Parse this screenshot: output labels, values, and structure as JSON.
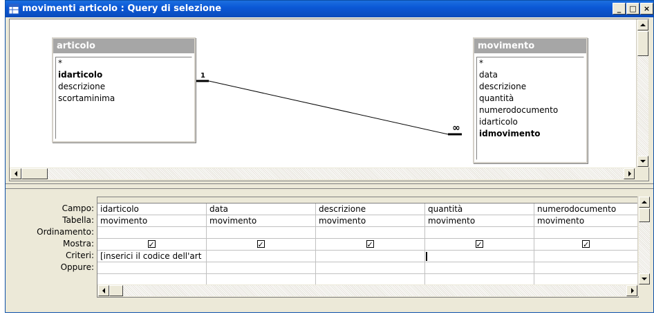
{
  "window": {
    "title": "movimenti articolo : Query di selezione",
    "controls": [
      "minimize",
      "maximize",
      "close"
    ]
  },
  "upper_pane": {
    "tables": [
      {
        "name": "articolo",
        "fields": [
          {
            "label": "*",
            "key": false
          },
          {
            "label": "idarticolo",
            "key": true
          },
          {
            "label": "descrizione",
            "key": false
          },
          {
            "label": "scortaminima",
            "key": false
          }
        ]
      },
      {
        "name": "movimento",
        "fields": [
          {
            "label": "*",
            "key": false
          },
          {
            "label": "data",
            "key": false
          },
          {
            "label": "descrizione",
            "key": false
          },
          {
            "label": "quantità",
            "key": false
          },
          {
            "label": "numerodocumento",
            "key": false
          },
          {
            "label": "idarticolo",
            "key": false
          },
          {
            "label": "idmovimento",
            "key": true
          }
        ]
      }
    ],
    "relationship": {
      "one_label": "1",
      "many_label": "∞"
    }
  },
  "grid": {
    "row_labels": [
      "Campo:",
      "Tabella:",
      "Ordinamento:",
      "Mostra:",
      "Criteri:",
      "Oppure:"
    ],
    "columns": [
      {
        "campo": "idarticolo",
        "tabella": "movimento",
        "mostra": true,
        "criteri": "[inserici il codice dell'art"
      },
      {
        "campo": "data",
        "tabella": "movimento",
        "mostra": true,
        "criteri": ""
      },
      {
        "campo": "descrizione",
        "tabella": "movimento",
        "mostra": true,
        "criteri": ""
      },
      {
        "campo": "quantità",
        "tabella": "movimento",
        "mostra": true,
        "criteri": ""
      },
      {
        "campo": "numerodocumento",
        "tabella": "movimento",
        "mostra": true,
        "criteri": ""
      }
    ]
  }
}
